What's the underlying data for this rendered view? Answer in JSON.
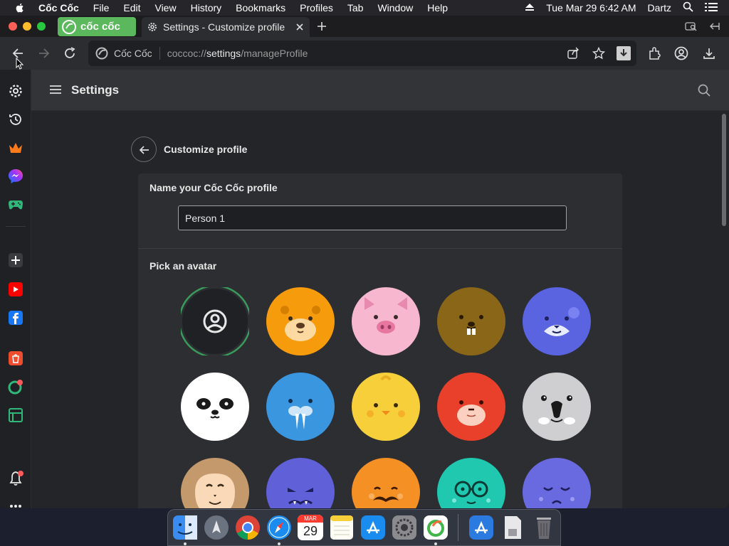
{
  "menubar": {
    "app": "Cốc Cốc",
    "items": [
      "File",
      "Edit",
      "View",
      "History",
      "Bookmarks",
      "Profiles",
      "Tab",
      "Window",
      "Help"
    ],
    "datetime": "Tue Mar 29  6:42 AM",
    "user": "Dartz"
  },
  "tabs": {
    "brand_label": "cốc cốc",
    "active_title": "Settings - Customize profile"
  },
  "omnibox": {
    "site": "Cốc Cốc",
    "url_prefix": "coccoc://",
    "url_host": "settings",
    "url_path": "/manageProfile"
  },
  "page": {
    "title": "Settings",
    "subtitle": "Customize profile",
    "name_section_label": "Name your Cốc Cốc profile",
    "name_value": "Person 1",
    "avatar_section_label": "Pick an avatar"
  },
  "avatars": [
    "default-person",
    "bear",
    "pig",
    "beaver",
    "cat",
    "panda",
    "walrus",
    "chick",
    "red-panda",
    "koala",
    "monkey",
    "blue-monster",
    "orange-mustache",
    "teal-glasses",
    "purple-sleepy"
  ],
  "colors": {
    "accent": "#5cb85c",
    "avatar_ring": "#3a9b5c"
  },
  "dock": {
    "calendar_month": "MAR",
    "calendar_day": "29"
  }
}
